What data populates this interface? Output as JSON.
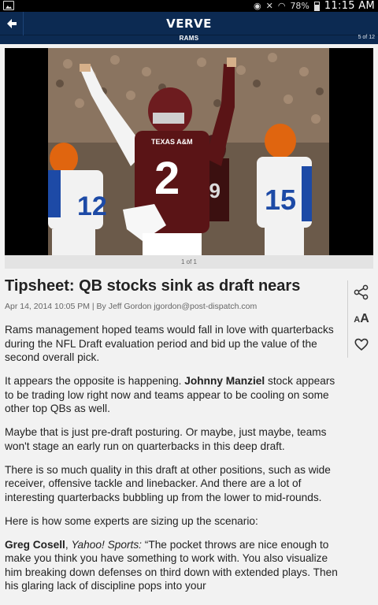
{
  "status_bar": {
    "battery": "78%",
    "time": "11:15 AM"
  },
  "header": {
    "brand": "VERVE",
    "section": "RAMS",
    "page_count": "5 of 12"
  },
  "photo": {
    "counter": "1 of 1",
    "center_jersey": "2",
    "center_chest": "TEXAS A&M",
    "left_jersey": "12",
    "right_jersey": "15",
    "back_jersey": "19"
  },
  "article": {
    "title": "Tipsheet: QB stocks sink as draft nears",
    "byline": "Apr 14, 2014 10:05 PM | By Jeff Gordon jgordon@post-dispatch.com",
    "p1": "Rams management hoped teams would fall in love with quarterbacks during the NFL Draft evaluation period and bid up the value of the second overall pick.",
    "p2_pre": "It appears the opposite is happening. ",
    "p2_name": "Johnny Manziel",
    "p2_post": " stock appears to be trading low right now and teams appear to be cooling on some other top QBs as well.",
    "p3": "Maybe that is just pre-draft posturing. Or maybe, just maybe, teams won't stage an early run on quarterbacks in this deep draft.",
    "p4": "There is so much quality in this draft at other positions, such as wide receiver, offensive tackle and linebacker. And there are a lot of interesting quarterbacks bubbling up from the lower to mid-rounds.",
    "p5": "Here is how some experts are sizing up the scenario:",
    "p6_name": "Greg Cosell",
    "p6_sep": ", ",
    "p6_pub": "Yahoo! Sports:",
    "p6_text": " “The pocket throws are nice enough to make you think you have something to work with. You also visualize him breaking down defenses on third down with extended plays. Then his glaring lack of discipline pops into your"
  },
  "tools": {
    "share_icon": "share-icon",
    "text_size_icon": "text-size-icon",
    "favorite_icon": "heart-icon"
  },
  "colors": {
    "header_bg": "#0c2a52",
    "text": "#222222",
    "byline": "#666666"
  }
}
